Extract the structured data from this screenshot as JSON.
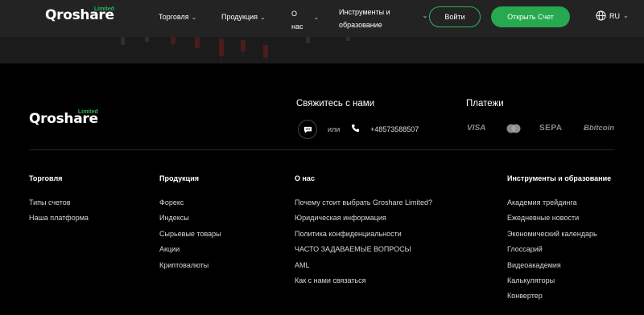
{
  "brand": {
    "name": "Qroshare",
    "tag": "Limited"
  },
  "header": {
    "nav": [
      {
        "label": "Торговля"
      },
      {
        "label": "Продукция"
      },
      {
        "label_line1": "О",
        "label_line2": "нас"
      },
      {
        "label_line1": "Инструменты и",
        "label_line2": "образование"
      }
    ],
    "login_label": "Войти",
    "open_account_label": "Открыть Счет",
    "language": "RU"
  },
  "footer": {
    "contact_title": "Свяжитесь с нами",
    "or_text": "или",
    "phone": "+48573588507",
    "payments_title": "Платежи",
    "payments": [
      "VISA",
      "mastercard",
      "SEPA",
      "bitcoin"
    ],
    "columns": [
      {
        "title": "Торговля",
        "items": [
          "Типы счетов",
          "Наша платформа"
        ]
      },
      {
        "title": "Продукция",
        "items": [
          "Форекс",
          "Индексы",
          "Сырьевые товары",
          "Акции",
          "Криптовалюты"
        ]
      },
      {
        "title": "О нас",
        "items": [
          "Почему стоит выбрать Groshare Limited?",
          "Юридическая информация",
          "Политика конфиденциальности",
          "ЧАСТО ЗАДАВАЕМЫЕ ВОПРОСЫ",
          "AML",
          "Как с нами связаться"
        ]
      },
      {
        "title": "Инструменты и образование",
        "items": [
          "Академия трейдинга",
          "Ежедневные новости",
          "Экономический календарь",
          "Глоссарий",
          "Видеоакадемия",
          "Калькуляторы",
          "Конвертер"
        ]
      }
    ]
  },
  "colors": {
    "accent": "#27a94f",
    "header_bg": "#232323",
    "footer_bg": "#000000"
  }
}
